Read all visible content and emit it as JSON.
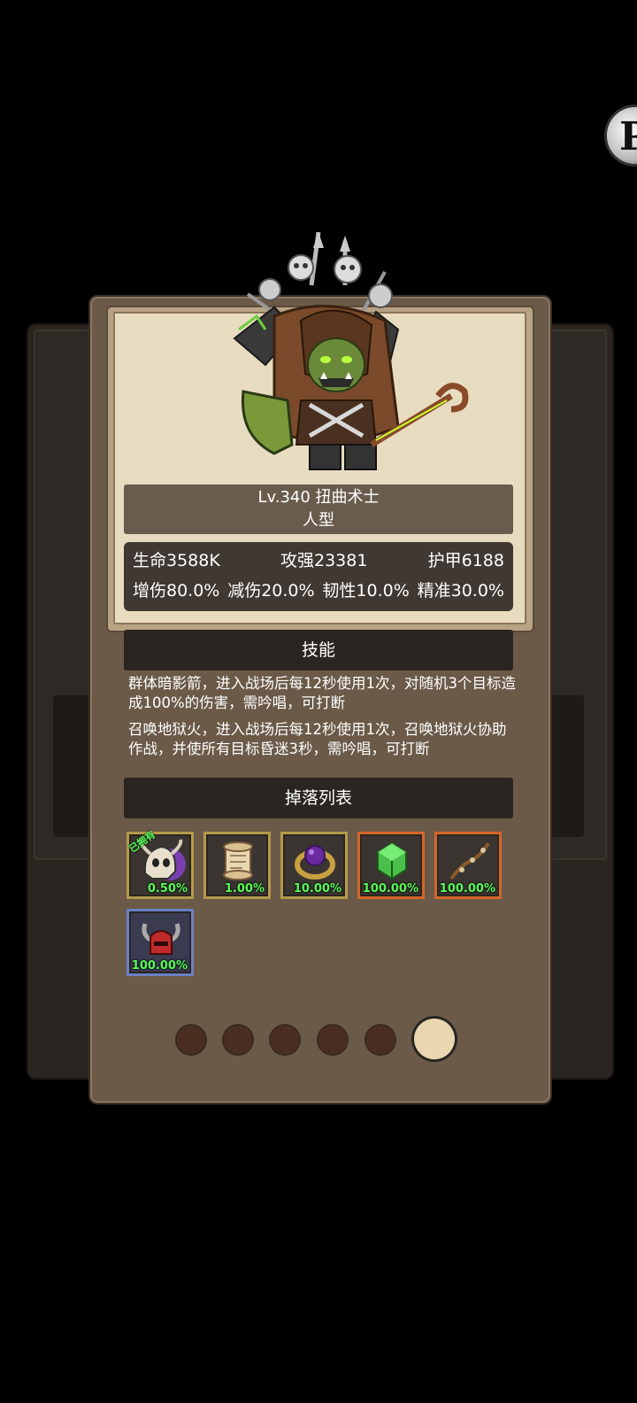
{
  "corner_button": {
    "icon": "profile-button-icon",
    "glyph": "P"
  },
  "monster": {
    "level_name": "Lv.340 扭曲术士",
    "type": "人型",
    "stats_row1": [
      "生命3588K",
      "攻强23381",
      "护甲6188"
    ],
    "stats_row2": [
      "增伤80.0%",
      "减伤20.0%",
      "韧性10.0%",
      "精准30.0%"
    ]
  },
  "skills": {
    "header": "技能",
    "items": [
      "群体暗影箭，进入战场后每12秒使用1次，对随机3个目标造成100%的伤害，需吟唱，可打断",
      "召唤地狱火，进入战场后每12秒使用1次，召唤地狱火协助作战，并使所有目标昏迷3秒，需吟唱，可打断"
    ]
  },
  "drops": {
    "header": "掉落列表",
    "owned_tag": "已拥有",
    "items": [
      {
        "icon": "skull-helmet-icon",
        "percent": "0.50%",
        "rarity": "gold"
      },
      {
        "icon": "scroll-icon",
        "percent": "1.00%",
        "rarity": "gold"
      },
      {
        "icon": "purple-gem-ring-icon",
        "percent": "10.00%",
        "rarity": "gold"
      },
      {
        "icon": "green-crystal-icon",
        "percent": "100.00%",
        "rarity": "orange"
      },
      {
        "icon": "bone-bow-icon",
        "percent": "100.00%",
        "rarity": "orange"
      },
      {
        "icon": "horned-red-helmet-icon",
        "percent": "100.00%",
        "rarity": "blue"
      }
    ]
  },
  "pagination": {
    "total": 6,
    "active_page": 6
  }
}
